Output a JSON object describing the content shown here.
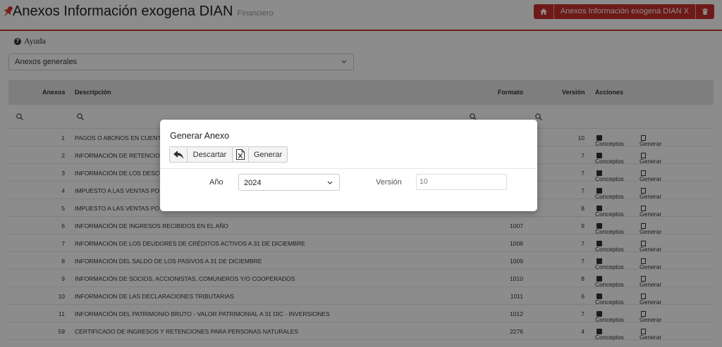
{
  "header": {
    "title": "Anexos Información exogena DIAN",
    "subtitle": "Financiero",
    "breadcrumb": {
      "current": "Anexos Información exogena DIAN",
      "close": "X"
    }
  },
  "help": {
    "label": "Ayuda"
  },
  "annex_select": {
    "value": "Anexos generales"
  },
  "table": {
    "headers": {
      "anexos": "Anexos",
      "descripcion": "Descripción",
      "formato": "Formato",
      "version": "Versión",
      "acciones": "Acciones"
    },
    "action_labels": {
      "conceptos": "Conceptos",
      "generar": "Generar"
    },
    "rows": [
      {
        "anexo": "1",
        "descripcion": "PAGOS O ABONOS EN CUENT",
        "formato": "",
        "version": "10"
      },
      {
        "anexo": "2",
        "descripcion": "INFORMACIÓN DE RETENCIO",
        "formato": "",
        "version": "7"
      },
      {
        "anexo": "3",
        "descripcion": "INFORMACIÓN DE LOS DESCU",
        "formato": "",
        "version": "7"
      },
      {
        "anexo": "4",
        "descripcion": "IMPUESTO A LAS VENTAS PO",
        "formato": "",
        "version": "7"
      },
      {
        "anexo": "5",
        "descripcion": "IMPUESTO A LAS VENTAS PO",
        "formato": "",
        "version": "8"
      },
      {
        "anexo": "6",
        "descripcion": "INFORMACIÓN DE INGRESOS RECIBIDOS EN EL AÑO",
        "formato": "1007",
        "version": "9"
      },
      {
        "anexo": "7",
        "descripcion": "INFORMACIÓN DE LOS DEUDORES DE CRÉDITOS ACTIVOS A 31 DE DICIEMBRE",
        "formato": "1008",
        "version": "7"
      },
      {
        "anexo": "8",
        "descripcion": "INFORMACIÓN DEL SALDO DE LOS PASIVOS A 31 DE DICIEMBRE",
        "formato": "1009",
        "version": "7"
      },
      {
        "anexo": "9",
        "descripcion": "INFORMACIÓN DE SOCIOS, ACCIONISTAS, COMUNEROS Y/O COOPERADOS",
        "formato": "1010",
        "version": "8"
      },
      {
        "anexo": "10",
        "descripcion": "INFORMACION DE LAS DECLARACIONES TRIBUTARIAS",
        "formato": "1011",
        "version": "6"
      },
      {
        "anexo": "11",
        "descripcion": "INFORMACIÓN DEL PATRIMONIO BRUTO - VALOR PATRIMONIAL A 31 DIC - INVERSIONES",
        "formato": "1012",
        "version": "7"
      },
      {
        "anexo": "59",
        "descripcion": "CERTIFICADO DE INGRESOS Y RETENCIONES PARA PERSONAS NATURALES",
        "formato": "2276",
        "version": "4"
      }
    ]
  },
  "modal": {
    "title": "Generar Anexo",
    "discard_label": "Descartar",
    "generate_label": "Generar",
    "year_label": "Año",
    "year_value": "2024",
    "version_label": "Versión",
    "version_placeholder": "10"
  },
  "colors": {
    "accent": "#c9302c",
    "header_bg": "#e6e6e6"
  }
}
